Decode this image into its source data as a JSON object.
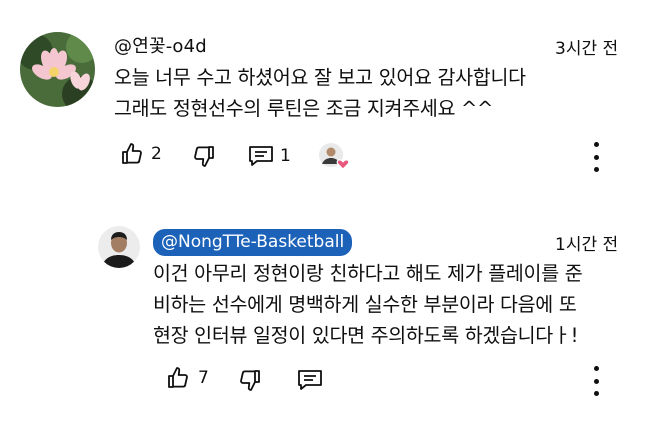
{
  "comments": [
    {
      "handle": "@연꽃-o4d",
      "time": "3시간 전",
      "lines": [
        "오늘  너무  수고 하셨어요 잘 보고 있어요 감사합니다",
        "그래도 정현선수의 루틴은  조금 지켜주세요 ^^"
      ],
      "likes": "2",
      "replies": "1"
    },
    {
      "handle": "@NongTTe-Basketball",
      "time": "1시간 전",
      "lines": [
        "이건 아무리 정현이랑 친하다고 해도 제가 플레이를 준",
        "비하는 선수에게 명백하게 실수한 부분이라 다음에 또",
        "현장 인터뷰 일정이 있다면 주의하도록 하겠습니다ㅏ!"
      ],
      "likes": "7",
      "chip_color": "#1c62b9"
    }
  ],
  "icons": {
    "like": "thumbs-up-icon",
    "dislike": "thumbs-down-icon",
    "reply": "comment-icon",
    "more": "more-vert-icon",
    "heart": "creator-heart-icon"
  }
}
